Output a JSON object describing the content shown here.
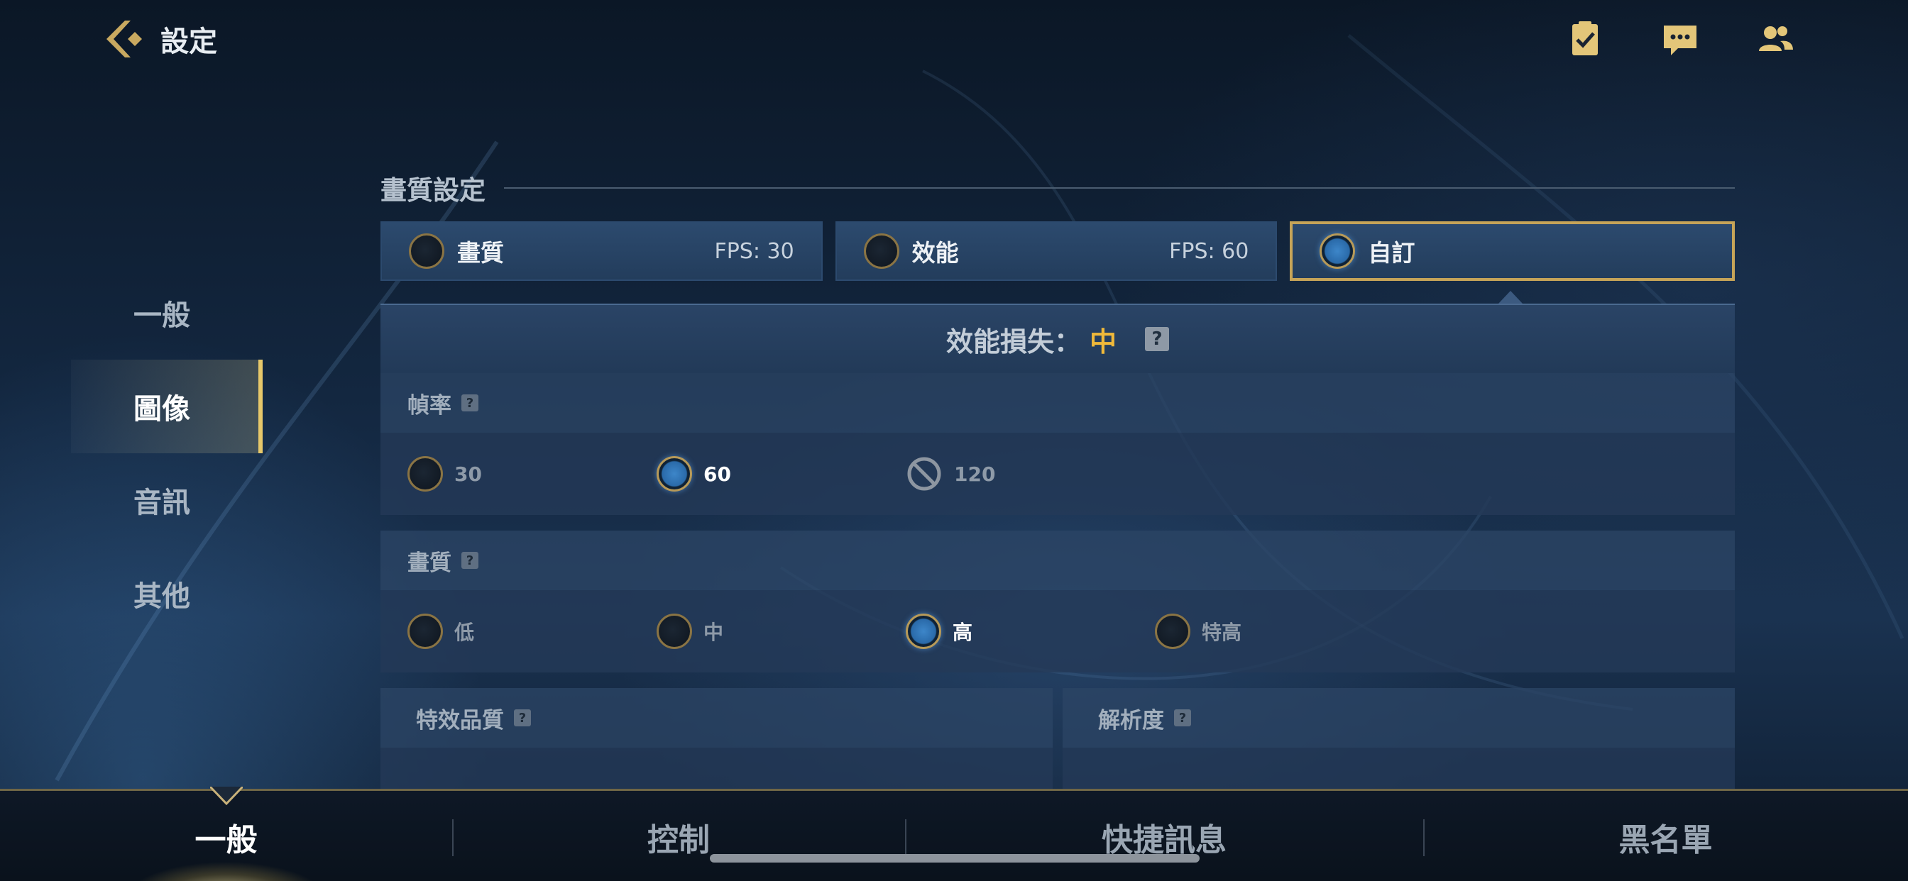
{
  "header": {
    "title": "設定"
  },
  "sidebar": {
    "items": [
      {
        "label": "一般",
        "active": false
      },
      {
        "label": "圖像",
        "active": true
      },
      {
        "label": "音訊",
        "active": false
      },
      {
        "label": "其他",
        "active": false
      }
    ]
  },
  "quality_section": {
    "title": "畫質設定",
    "presets": [
      {
        "label": "畫質",
        "fps": "FPS:  30",
        "selected": false
      },
      {
        "label": "效能",
        "fps": "FPS:  60",
        "selected": false
      },
      {
        "label": "自訂",
        "fps": "",
        "selected": true
      }
    ],
    "performance_loss_label": "效能損失：",
    "performance_loss_value": "中",
    "help_glyph": "?"
  },
  "frame_rate": {
    "label": "幀率",
    "options": [
      {
        "label": "30",
        "state": "off"
      },
      {
        "label": "60",
        "state": "on"
      },
      {
        "label": "120",
        "state": "disabled"
      }
    ]
  },
  "graphics": {
    "label": "畫質",
    "options": [
      {
        "label": "低",
        "state": "off"
      },
      {
        "label": "中",
        "state": "off"
      },
      {
        "label": "高",
        "state": "on"
      },
      {
        "label": "特高",
        "state": "off"
      }
    ]
  },
  "effects_quality": {
    "label": "特效品質"
  },
  "resolution": {
    "label": "解析度"
  },
  "bottom_tabs": [
    {
      "label": "一般",
      "active": true
    },
    {
      "label": "控制",
      "active": false
    },
    {
      "label": "快捷訊息",
      "active": false
    },
    {
      "label": "黑名單",
      "active": false
    }
  ],
  "colors": {
    "accent_gold": "#c6a458",
    "loss_value": "#f0b93a",
    "radio_on": "#3d86c9"
  }
}
